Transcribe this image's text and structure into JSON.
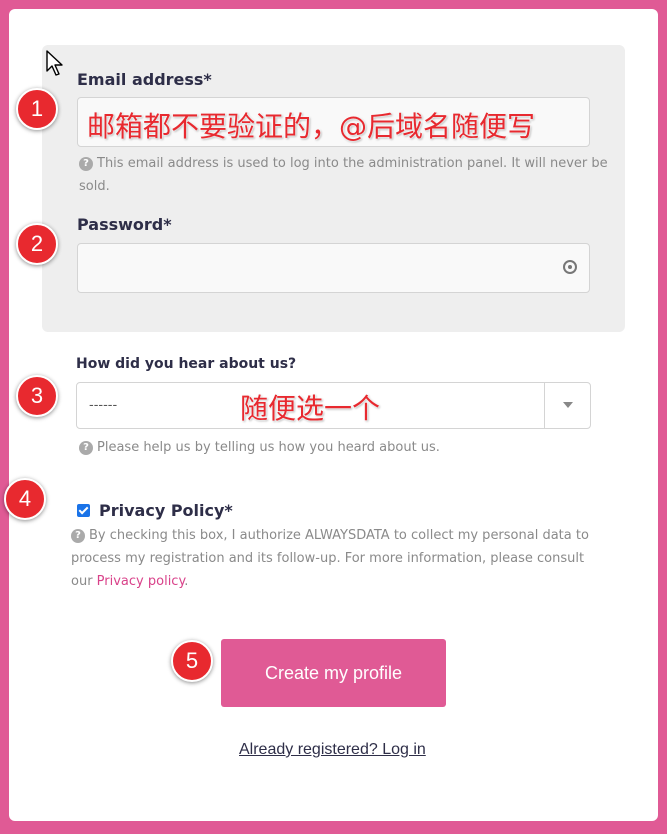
{
  "form": {
    "email_label": "Email address*",
    "email_value": "",
    "email_help": "This email address is used to log into the administration panel. It will never be sold.",
    "password_label": "Password*",
    "hear_label": "How did you hear about us?",
    "hear_selected": "------",
    "hear_help": "Please help us by telling us how you heard about us.",
    "privacy_label": "Privacy Policy*",
    "privacy_checked": true,
    "privacy_help": "By checking this box, I authorize ALWAYSDATA to collect my personal data to process my registration and its follow-up. For more information, please consult our ",
    "privacy_link": "Privacy policy",
    "privacy_help_end": ".",
    "submit_label": "Create my profile",
    "login_link": "Already registered? Log in"
  },
  "annotations": {
    "markers": [
      "1",
      "2",
      "3",
      "4",
      "5"
    ],
    "note_email": "邮箱都不要验证的，@后域名随便写",
    "note_select": "随便选一个"
  },
  "icons": {
    "help": "question-circle-icon",
    "password_reveal": "key-icon",
    "dropdown": "caret-down-icon",
    "cursor": "mouse-pointer-icon"
  },
  "colors": {
    "brand": "#e05a95",
    "annotation": "#e8292f",
    "checkbox": "#1a73e8"
  }
}
